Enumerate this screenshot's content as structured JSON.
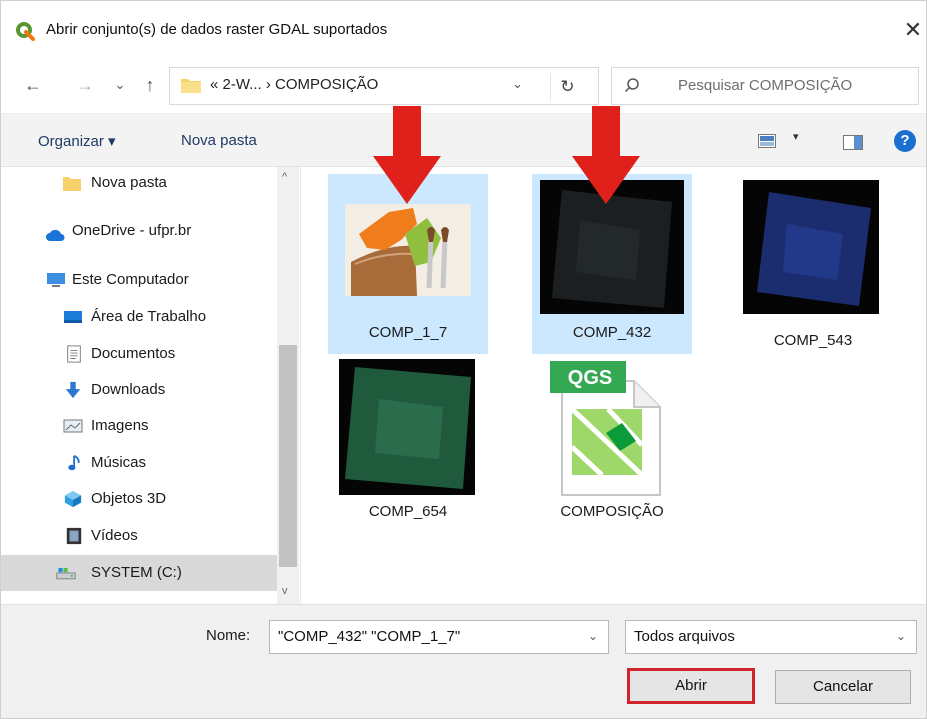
{
  "window": {
    "title": "Abrir conjunto(s) de dados raster GDAL suportados",
    "close_glyph": "✕"
  },
  "nav": {
    "back_glyph": "←",
    "forward_glyph": "→",
    "recent_glyph": "⌄",
    "up_glyph": "↑",
    "address": {
      "path": "« 2-W...  ›  COMPOSIÇÃO",
      "dropdown_glyph": "⌄",
      "refresh_glyph": "↻"
    },
    "search": {
      "placeholder": "Pesquisar COMPOSIÇÃO"
    }
  },
  "toolbar": {
    "organize_label": "Organizar ▾",
    "new_folder_label": "Nova pasta",
    "view_dropdown_glyph": "▾",
    "help_glyph": "?"
  },
  "sidebar": {
    "items": [
      {
        "label": "Nova pasta",
        "icon": "folder-icon"
      },
      {
        "label": "OneDrive - ufpr.br",
        "icon": "cloud-icon"
      },
      {
        "label": "Este Computador",
        "icon": "computer-icon"
      },
      {
        "label": "Área de Trabalho",
        "icon": "desktop-icon"
      },
      {
        "label": "Documentos",
        "icon": "document-icon"
      },
      {
        "label": "Downloads",
        "icon": "download-icon"
      },
      {
        "label": "Imagens",
        "icon": "image-icon"
      },
      {
        "label": "Músicas",
        "icon": "music-icon"
      },
      {
        "label": "Objetos 3D",
        "icon": "cube-icon"
      },
      {
        "label": "Vídeos",
        "icon": "video-icon"
      },
      {
        "label": "SYSTEM (C:)",
        "icon": "drive-icon",
        "selected": true
      }
    ],
    "scroll_up_glyph": "^",
    "scroll_down_glyph": "v"
  },
  "files": [
    {
      "name": "COMP_1_7",
      "type": "qgis-raster-icon",
      "selected": true
    },
    {
      "name": "COMP_432",
      "type": "raster-dark",
      "selected": true
    },
    {
      "name": "COMP_543",
      "type": "raster-blue",
      "selected": false
    },
    {
      "name": "COMP_654",
      "type": "raster-green",
      "selected": false
    },
    {
      "name": "COMPOSIÇÃO",
      "type": "qgs-project",
      "badge": "QGS",
      "selected": false
    }
  ],
  "annotations": {
    "arrow_color": "#e0201b",
    "count": 2
  },
  "bottom": {
    "name_label": "Nome:",
    "name_value": "\"COMP_432\" \"COMP_1_7\"",
    "filter_value": "Todos arquivos",
    "dropdown_glyph": "⌄",
    "open_label": "Abrir",
    "cancel_label": "Cancelar",
    "open_highlight_color": "#d2232a"
  },
  "colors": {
    "selection": "#cce8ff",
    "toolbar_bg": "#f3f3f3",
    "link_text": "#1f3a66",
    "help_blue": "#1a6fd1"
  }
}
